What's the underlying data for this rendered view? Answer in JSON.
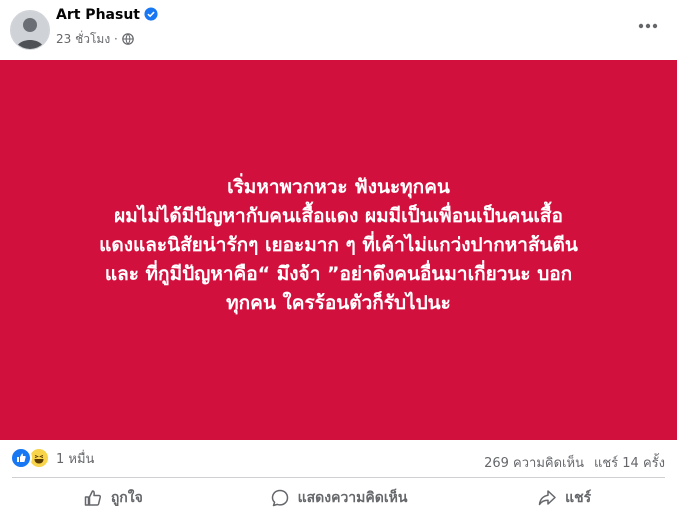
{
  "post": {
    "author": "Art Phasut",
    "time": "23 ชั่วโมง",
    "separator": "·",
    "banner_color": "#d2103e",
    "banner_lines": [
      "เริ่มหาพวกหวะ ฟังนะทุกคน",
      "ผมไม่ได้มีปัญหากับคนเสื้อแดง ผมมีเป็นเพื่อนเป็นคนเสื้อ",
      "แดงและนิสัยน่ารักๆ เยอะมาก ๆ ที่เค้าไม่แกว่งปากหาส้นตีน",
      "และ ที่กูมีปัญหาคือ“ มึงจ้า ”อย่าดึงคนอื่นมาเกี่ยวนะ บอก",
      "ทุกคน ใครร้อนตัวก็รับไปนะ"
    ]
  },
  "stats": {
    "reactions_count": "1 หมื่น",
    "comments": "269 ความคิดเห็น",
    "shares": "แชร์ 14 ครั้ง"
  },
  "actions": {
    "like": "ถูกใจ",
    "comment": "แสดงความคิดเห็น",
    "share": "แชร์"
  },
  "icons": {
    "verified": "verified-badge-icon",
    "privacy": "globe-icon",
    "more": "more-options-icon",
    "reaction_like": "like-reaction-icon",
    "reaction_haha": "haha-reaction-icon"
  }
}
